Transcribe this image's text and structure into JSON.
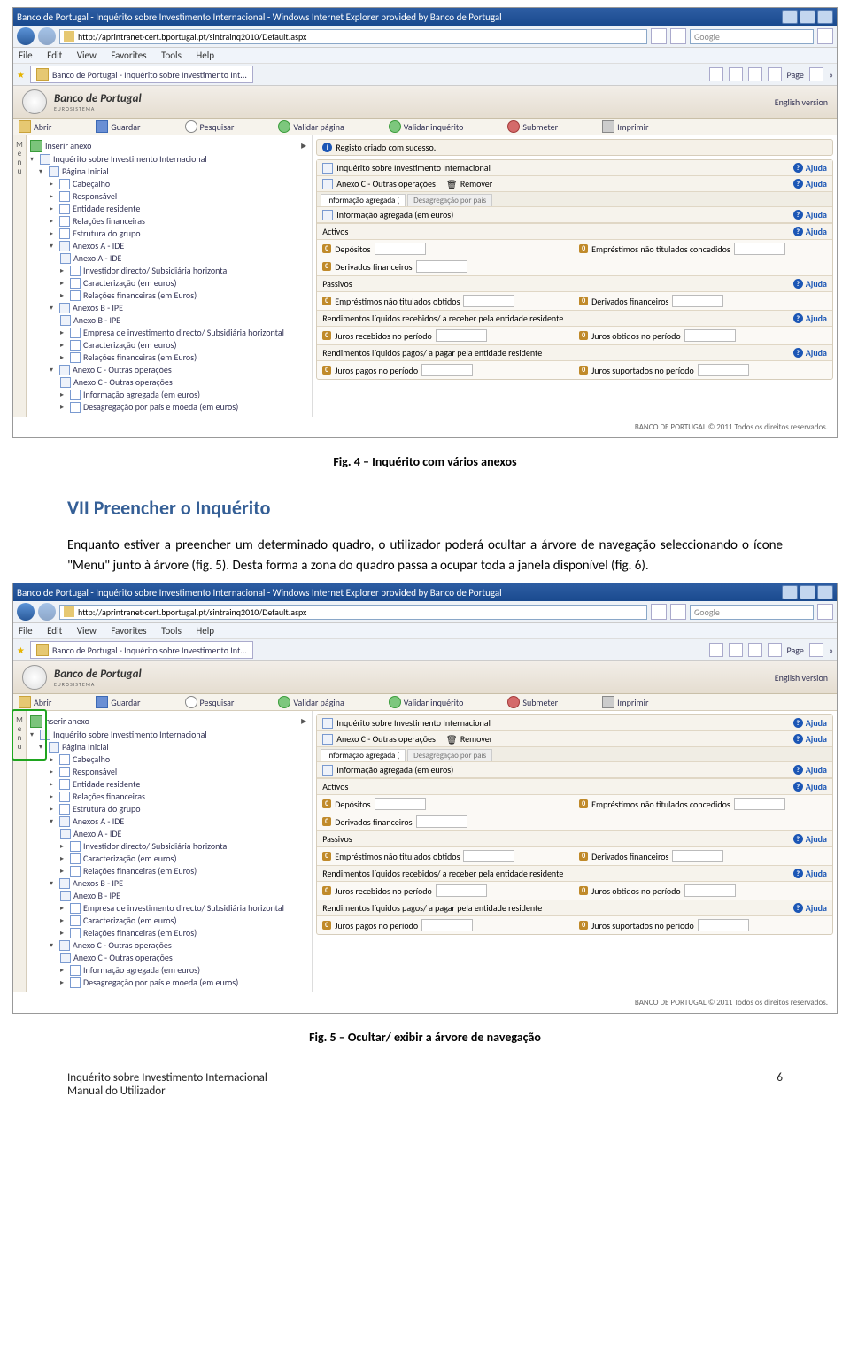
{
  "browser": {
    "title": "Banco de Portugal - Inquérito sobre Investimento Internacional - Windows Internet Explorer provided by Banco de Portugal",
    "url": "http://aprintranet-cert.bportugal.pt/sintrainq2010/Default.aspx",
    "search_placeholder": "Google",
    "menus": [
      "File",
      "Edit",
      "View",
      "Favorites",
      "Tools",
      "Help"
    ],
    "tab_label": "Banco de Portugal - Inquérito sobre Investimento Int...",
    "tool_labels": {
      "page": "Page",
      "chevron": "»"
    }
  },
  "app": {
    "bank_name": "Banco de Portugal",
    "bank_sub": "EUROSISTEMA",
    "english": "English version",
    "toolbar": {
      "abrir": "Abrir",
      "guardar": "Guardar",
      "pesquisar": "Pesquisar",
      "validar_pagina": "Validar página",
      "validar_inquerito": "Validar inquérito",
      "submeter": "Submeter",
      "imprimir": "Imprimir"
    },
    "insert_anexo": "Inserir anexo",
    "insert_anexo_alt": "nserir anexo",
    "menu_letters": [
      "M",
      "e",
      "n",
      "u"
    ],
    "tree": {
      "root": "Inquérito sobre Investimento Internacional",
      "n1": "Página Inicial",
      "n2": "Cabeçalho",
      "n3": "Responsável",
      "n4": "Entidade residente",
      "n5": "Relações financeiras",
      "n6": "Estrutura do grupo",
      "n7": "Anexos A - IDE",
      "n8": "Anexo A - IDE",
      "n9": "Investidor directo/ Subsidiária horizontal",
      "n10": "Caracterização (em euros)",
      "n11": "Relações financeiras (em Euros)",
      "n12": "Anexos B - IPE",
      "n13": "Anexo B - IPE",
      "n14": "Empresa de investimento directo/ Subsidiária horizontal",
      "n15": "Caracterização (em euros)",
      "n16": "Relações financeiras (em Euros)",
      "n17": "Anexo C - Outras operações",
      "n18": "Anexo C - Outras operações",
      "n19": "Informação agregada (em euros)",
      "n20": "Desagregação por país e moeda (em euros)"
    },
    "notice": "Registo criado com sucesso.",
    "ajuda": "Ajuda",
    "panel1_title": "Inquérito sobre Investimento Internacional",
    "panel2_title": "Anexo C - Outras operações",
    "remover": "Remover",
    "tabs": {
      "t1": "Informação agregada (",
      "t2": "Desagregação por país"
    },
    "panel3_title": "Informação agregada (em euros)",
    "sections": {
      "activos": "Activos",
      "passivos": "Passivos",
      "rend_rec": "Rendimentos líquidos recebidos/ a receber pela entidade residente",
      "rend_pag": "Rendimentos líquidos pagos/ a pagar pela entidade residente"
    },
    "fields": {
      "depositos": "Depósitos",
      "emp_nao_tit_conc": "Empréstimos não titulados concedidos",
      "derivados": "Derivados financeiros",
      "emp_nao_tit_obt": "Empréstimos não titulados obtidos",
      "juros_rec": "Juros recebidos no período",
      "juros_obt": "Juros obtidos no período",
      "juros_pag": "Juros pagos no período",
      "juros_sup": "Juros suportados no período"
    },
    "footer": "BANCO DE PORTUGAL © 2011 Todos os direitos reservados."
  },
  "doc": {
    "cap1": "Fig. 4 – Inquérito com vários anexos",
    "h2": "VII  Preencher o Inquérito",
    "p1": "Enquanto estiver a preencher um determinado quadro, o utilizador poderá ocultar a árvore de navegação seleccionando o ícone \"Menu\" junto à árvore (fig. 5). Desta forma a zona do quadro passa a ocupar toda a janela disponível (fig. 6).",
    "cap2": "Fig. 5 – Ocultar/ exibir a árvore de navegação",
    "foot1": "Inquérito sobre Investimento Internacional",
    "foot2": "Manual do Utilizador",
    "page_num": "6"
  }
}
